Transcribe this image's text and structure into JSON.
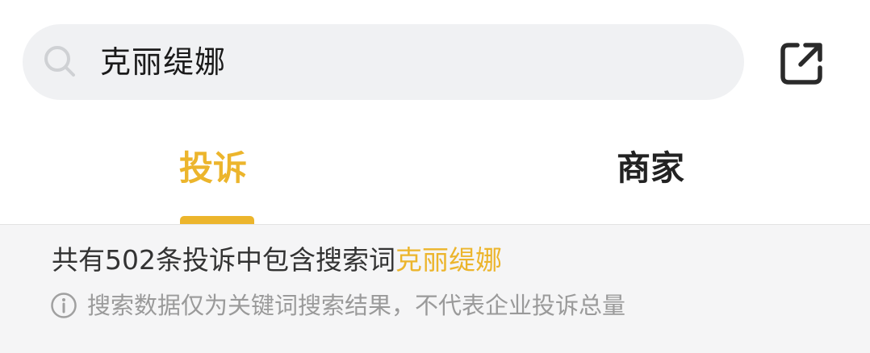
{
  "search": {
    "query": "克丽缇娜",
    "icon": "search-icon"
  },
  "header": {
    "share_icon": "external-link-icon"
  },
  "tabs": [
    {
      "label": "投诉",
      "active": true
    },
    {
      "label": "商家",
      "active": false
    }
  ],
  "results": {
    "summary_prefix": "共有502条投诉中包含搜索词",
    "summary_keyword": "克丽缇娜",
    "disclaimer": "搜索数据仅为关键词搜索结果，不代表企业投诉总量",
    "disclaimer_icon": "info-icon"
  },
  "colors": {
    "accent": "#ecb52c",
    "search_bg": "#f0f1f3",
    "panel_bg": "#f5f5f6"
  }
}
